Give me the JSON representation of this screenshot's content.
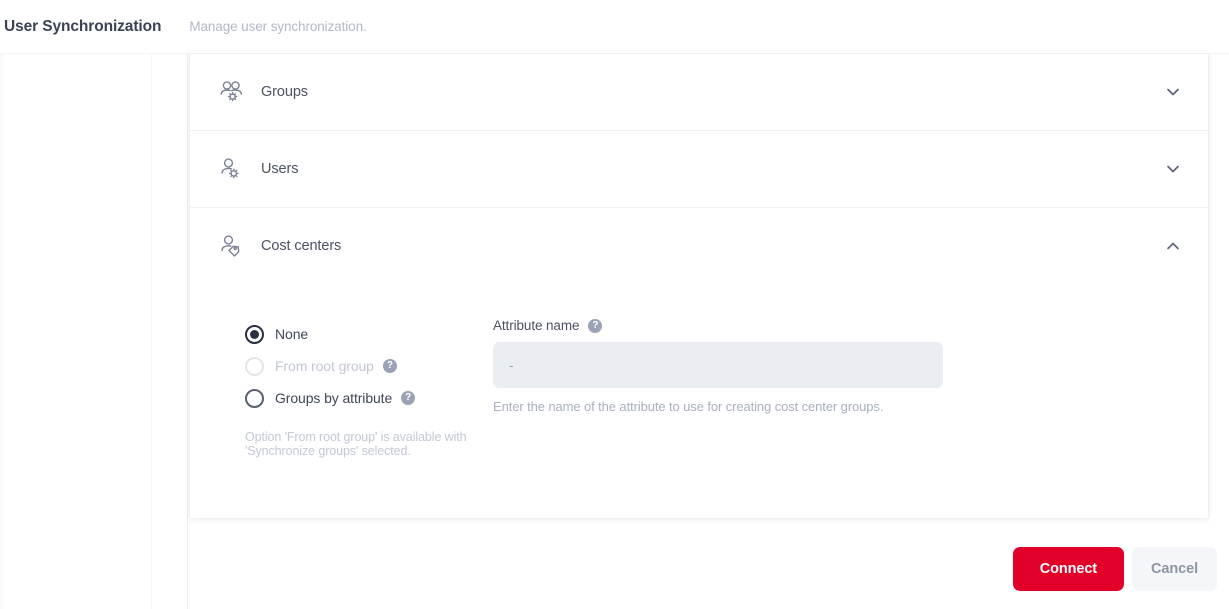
{
  "header": {
    "title": "User Synchronization",
    "subtitle": "Manage user synchronization."
  },
  "accordion": {
    "sections": [
      {
        "id": "groups",
        "label": "Groups",
        "icon": "users-gear-icon",
        "expanded": false,
        "chevron": "chevron-down-icon"
      },
      {
        "id": "users",
        "label": "Users",
        "icon": "user-gear-icon",
        "expanded": false,
        "chevron": "chevron-down-icon"
      },
      {
        "id": "cost-centers",
        "label": "Cost centers",
        "icon": "user-tag-icon",
        "expanded": true,
        "chevron": "chevron-up-icon"
      }
    ]
  },
  "cost_centers": {
    "radio_group": {
      "selected": "none",
      "options": [
        {
          "id": "none",
          "label": "None",
          "selected": true,
          "disabled": false,
          "help": false
        },
        {
          "id": "from-root-group",
          "label": "From root group",
          "selected": false,
          "disabled": true,
          "help": true
        },
        {
          "id": "groups-by-attribute",
          "label": "Groups by attribute",
          "selected": false,
          "disabled": false,
          "help": true
        }
      ]
    },
    "note": "Option 'From root group' is available with 'Synchronize groups' selected.",
    "attribute_field": {
      "label": "Attribute name",
      "help": true,
      "value": "",
      "placeholder": "-",
      "disabled": true,
      "hint": "Enter the name of the attribute to use for creating cost center groups."
    }
  },
  "footer": {
    "connect_label": "Connect",
    "cancel_label": "Cancel"
  },
  "icons": {
    "help": "?"
  },
  "colors": {
    "accent_red": "#e2002a",
    "text_dark": "#3a4256",
    "text_muted": "#b3b8c8",
    "input_disabled_bg": "#eaeef3",
    "secondary_btn_bg": "#f4f6fa"
  }
}
